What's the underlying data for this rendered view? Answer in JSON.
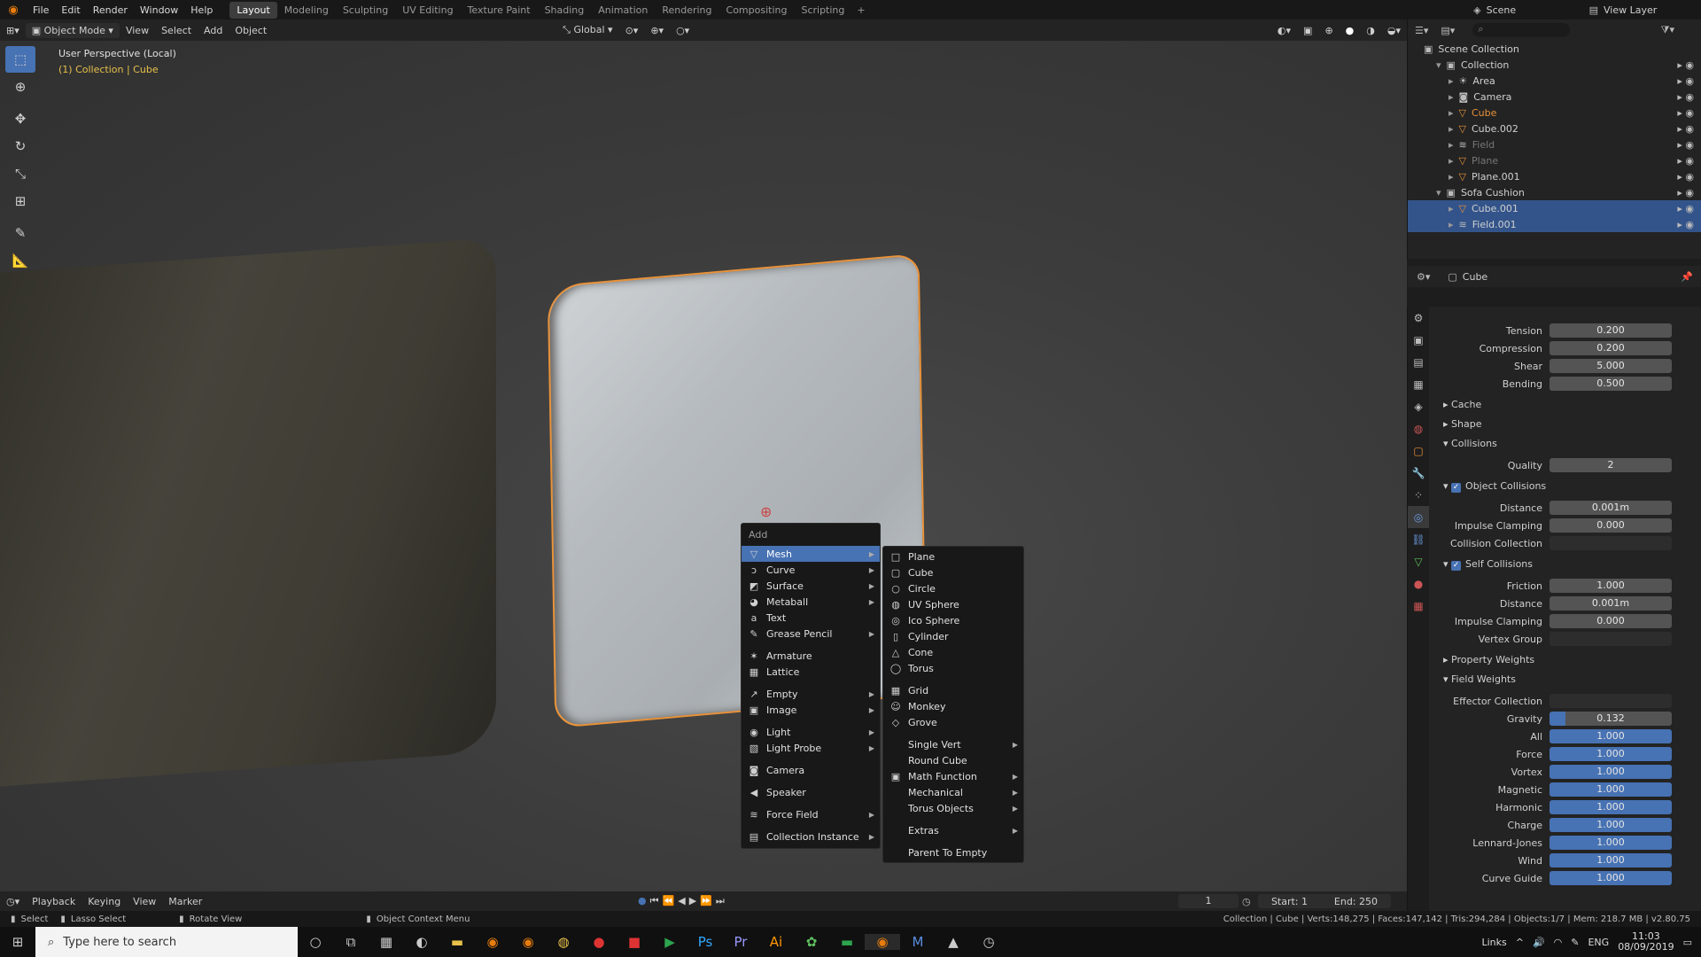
{
  "topbar": {
    "menus": [
      "File",
      "Edit",
      "Render",
      "Window",
      "Help"
    ],
    "workspaces": [
      "Layout",
      "Modeling",
      "Sculpting",
      "UV Editing",
      "Texture Paint",
      "Shading",
      "Animation",
      "Rendering",
      "Compositing",
      "Scripting"
    ],
    "scene": "Scene",
    "view_layer": "View Layer"
  },
  "viewport_header": {
    "mode": "Object Mode",
    "menus": [
      "View",
      "Select",
      "Add",
      "Object"
    ],
    "transform": "Global"
  },
  "viewport": {
    "perspective": "User Perspective (Local)",
    "collection_info": "(1) Collection | Cube"
  },
  "add_menu": {
    "title": "Add",
    "items": [
      {
        "label": "Mesh",
        "icon": "▽",
        "arrow": true,
        "hl": true
      },
      {
        "label": "Curve",
        "icon": "ↄ",
        "arrow": true
      },
      {
        "label": "Surface",
        "icon": "◩",
        "arrow": true
      },
      {
        "label": "Metaball",
        "icon": "◕",
        "arrow": true
      },
      {
        "label": "Text",
        "icon": "a",
        "arrow": false
      },
      {
        "label": "Grease Pencil",
        "icon": "✎",
        "arrow": true
      },
      {
        "gap": true
      },
      {
        "label": "Armature",
        "icon": "✶",
        "arrow": false
      },
      {
        "label": "Lattice",
        "icon": "▦",
        "arrow": false
      },
      {
        "gap": true
      },
      {
        "label": "Empty",
        "icon": "↗",
        "arrow": true
      },
      {
        "label": "Image",
        "icon": "▣",
        "arrow": true
      },
      {
        "gap": true
      },
      {
        "label": "Light",
        "icon": "◉",
        "arrow": true
      },
      {
        "label": "Light Probe",
        "icon": "▧",
        "arrow": true
      },
      {
        "gap": true
      },
      {
        "label": "Camera",
        "icon": "◙",
        "arrow": false
      },
      {
        "gap": true
      },
      {
        "label": "Speaker",
        "icon": "◀",
        "arrow": false
      },
      {
        "gap": true
      },
      {
        "label": "Force Field",
        "icon": "≋",
        "arrow": true
      },
      {
        "gap": true
      },
      {
        "label": "Collection Instance",
        "icon": "▤",
        "arrow": true
      }
    ]
  },
  "mesh_menu": [
    {
      "label": "Plane",
      "icon": "□"
    },
    {
      "label": "Cube",
      "icon": "▢"
    },
    {
      "label": "Circle",
      "icon": "○"
    },
    {
      "label": "UV Sphere",
      "icon": "◍"
    },
    {
      "label": "Ico Sphere",
      "icon": "◎"
    },
    {
      "label": "Cylinder",
      "icon": "▯"
    },
    {
      "label": "Cone",
      "icon": "△"
    },
    {
      "label": "Torus",
      "icon": "◯"
    },
    {
      "gap": true
    },
    {
      "label": "Grid",
      "icon": "▦"
    },
    {
      "label": "Monkey",
      "icon": "☺"
    },
    {
      "label": "Grove",
      "icon": "◇"
    },
    {
      "gap": true
    },
    {
      "label": "Single Vert",
      "icon": "",
      "arrow": true
    },
    {
      "label": "Round Cube",
      "icon": ""
    },
    {
      "label": "Math Function",
      "icon": "▣",
      "arrow": true
    },
    {
      "label": "Mechanical",
      "icon": "",
      "arrow": true
    },
    {
      "label": "Torus Objects",
      "icon": "",
      "arrow": true
    },
    {
      "gap": true
    },
    {
      "label": "Extras",
      "icon": "",
      "arrow": true
    },
    {
      "gap": true
    },
    {
      "label": "Parent To Empty",
      "icon": ""
    }
  ],
  "outliner": {
    "root": "Scene Collection",
    "rows": [
      {
        "label": "Collection",
        "indent": 1,
        "icon": "▣",
        "sel": false,
        "dim": false
      },
      {
        "label": "Area",
        "indent": 2,
        "icon": "☀",
        "sel": false,
        "dim": false
      },
      {
        "label": "Camera",
        "indent": 2,
        "icon": "◙",
        "sel": false,
        "dim": false
      },
      {
        "label": "Cube",
        "indent": 2,
        "icon": "▽",
        "sel": false,
        "dim": false,
        "active": true
      },
      {
        "label": "Cube.002",
        "indent": 2,
        "icon": "▽",
        "sel": false,
        "dim": false
      },
      {
        "label": "Field",
        "indent": 2,
        "icon": "≋",
        "sel": false,
        "dim": true
      },
      {
        "label": "Plane",
        "indent": 2,
        "icon": "▽",
        "sel": false,
        "dim": true
      },
      {
        "label": "Plane.001",
        "indent": 2,
        "icon": "▽",
        "sel": false,
        "dim": false
      },
      {
        "label": "Sofa Cushion",
        "indent": 1,
        "icon": "▣",
        "sel": false,
        "dim": false
      },
      {
        "label": "Cube.001",
        "indent": 2,
        "icon": "▽",
        "sel": true,
        "dim": false
      },
      {
        "label": "Field.001",
        "indent": 2,
        "icon": "≋",
        "sel": true,
        "dim": false
      }
    ]
  },
  "props": {
    "object": "Cube",
    "rows": [
      {
        "label": "Tension",
        "value": "0.200",
        "blue": false
      },
      {
        "label": "Compression",
        "value": "0.200",
        "blue": false
      },
      {
        "label": "Shear",
        "value": "5.000",
        "blue": false
      },
      {
        "label": "Bending",
        "value": "0.500",
        "blue": false
      }
    ],
    "sections": {
      "cache": "Cache",
      "shape": "Shape",
      "collisions": "Collisions",
      "object_collisions": "Object Collisions",
      "self_collisions": "Self Collisions",
      "property_weights": "Property Weights",
      "field_weights": "Field Weights"
    },
    "quality": {
      "label": "Quality",
      "value": "2"
    },
    "obj_col": [
      {
        "label": "Distance",
        "value": "0.001m"
      },
      {
        "label": "Impulse Clamping",
        "value": "0.000"
      },
      {
        "label": "Collision Collection",
        "value": ""
      }
    ],
    "self_col": [
      {
        "label": "Friction",
        "value": "1.000"
      },
      {
        "label": "Distance",
        "value": "0.001m"
      },
      {
        "label": "Impulse Clamping",
        "value": "0.000"
      },
      {
        "label": "Vertex Group",
        "value": ""
      }
    ],
    "effector": {
      "label": "Effector Collection",
      "value": ""
    },
    "weights": [
      {
        "label": "Gravity",
        "value": "0.132",
        "fill": 0.132
      },
      {
        "label": "All",
        "value": "1.000",
        "fill": 1
      },
      {
        "label": "Force",
        "value": "1.000",
        "fill": 1
      },
      {
        "label": "Vortex",
        "value": "1.000",
        "fill": 1
      },
      {
        "label": "Magnetic",
        "value": "1.000",
        "fill": 1
      },
      {
        "label": "Harmonic",
        "value": "1.000",
        "fill": 1
      },
      {
        "label": "Charge",
        "value": "1.000",
        "fill": 1
      },
      {
        "label": "Lennard-Jones",
        "value": "1.000",
        "fill": 1
      },
      {
        "label": "Wind",
        "value": "1.000",
        "fill": 1
      },
      {
        "label": "Curve Guide",
        "value": "1.000",
        "fill": 1
      }
    ]
  },
  "timeline": {
    "menus": [
      "Playback",
      "Keying",
      "View",
      "Marker"
    ],
    "frame": "1",
    "start_label": "Start:",
    "start": "1",
    "end_label": "End:",
    "end": "250"
  },
  "status": {
    "select": "Select",
    "lasso": "Lasso Select",
    "rotate": "Rotate View",
    "context": "Object Context Menu",
    "info": "Collection | Cube | Verts:148,275 | Faces:147,142 | Tris:294,284 | Objects:1/7 | Mem: 218.7 MB | v2.80.75"
  },
  "taskbar": {
    "search": "Type here to search",
    "links": "Links",
    "lang": "ENG",
    "time": "11:03",
    "date": "08/09/2019"
  },
  "colors": {
    "accent": "#4772b3",
    "selection_outline": "#e8923a",
    "panel": "#232323"
  }
}
